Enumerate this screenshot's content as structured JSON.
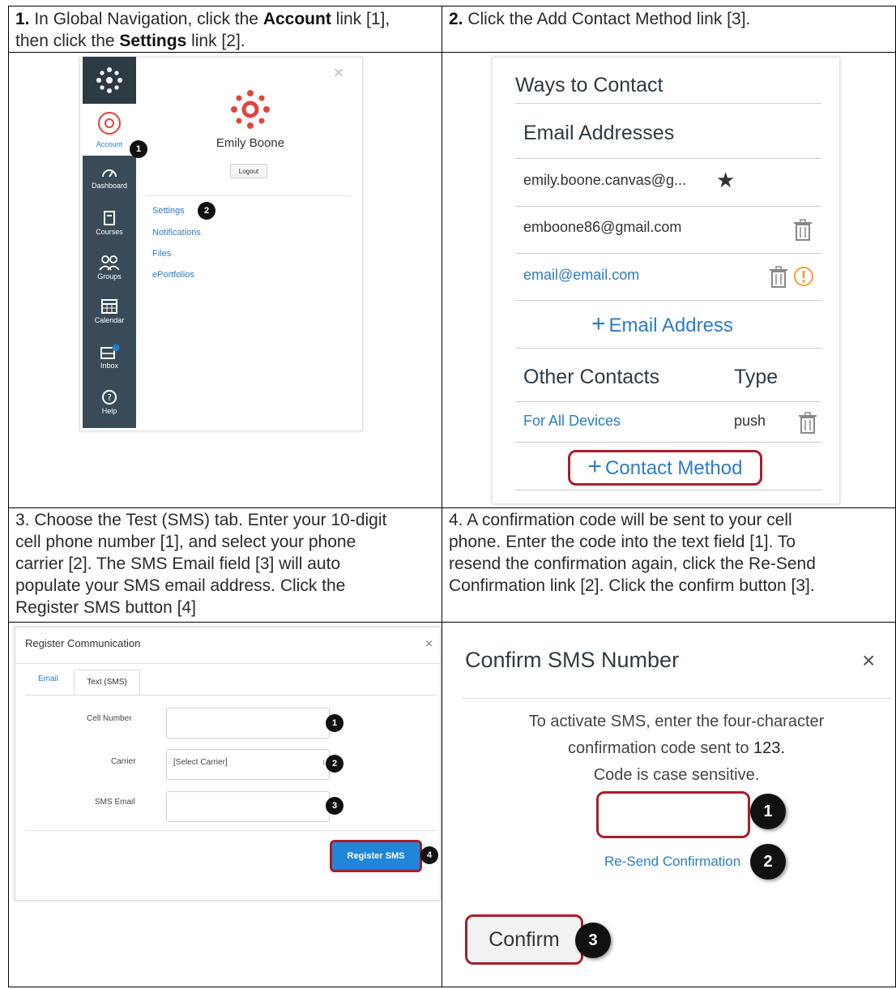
{
  "steps": {
    "s1": {
      "num": "1.",
      "t1": " In Global Navigation, click the ",
      "b1": "Account",
      "t2": " link [1],",
      "t3": "then click the ",
      "b2": "Settings",
      "t4": " link [2]."
    },
    "s2": {
      "num": "2.",
      "text": " Click the Add Contact Method link [3]."
    },
    "s3": {
      "lines": [
        "3. Choose the Test (SMS) tab. Enter your 10-digit",
        "cell phone number [1], and select your phone",
        "carrier [2]. The SMS Email field [3] will auto",
        "populate your SMS email address. Click the",
        "Register SMS button [4]"
      ]
    },
    "s4": {
      "lines": [
        "4. A confirmation code will be sent to your cell",
        "phone. Enter the code into the text field [1]. To",
        "resend the confirmation again, click the Re-Send",
        "Confirmation link [2]. Click the confirm button [3]."
      ]
    }
  },
  "panel1": {
    "nav": [
      "Account",
      "Dashboard",
      "Courses",
      "Groups",
      "Calendar",
      "Inbox",
      "Help"
    ],
    "user_name": "Emily Boone",
    "logout": "Logout",
    "links": [
      "Settings",
      "Notifications",
      "Files",
      "ePortfolios"
    ],
    "close": "×",
    "badges": [
      "1",
      "2"
    ]
  },
  "panel2": {
    "title": "Ways to Contact",
    "email_header": "Email Addresses",
    "emails": [
      "emily.boone.canvas@g...",
      "emboone86@gmail.com",
      "email@email.com"
    ],
    "add_email": "Email Address",
    "other_header": "Other Contacts",
    "type_header": "Type",
    "contact_name": "For All Devices",
    "contact_type": "push",
    "add_contact": "Contact Method",
    "colors": {
      "link": "#2d7cc3",
      "highlight": "#a51f2b"
    }
  },
  "panel3": {
    "title": "Register Communication",
    "close": "×",
    "tabs": [
      "Email",
      "Text (SMS)"
    ],
    "labels": [
      "Cell Number",
      "Carrier",
      "SMS Email"
    ],
    "carrier_value": "[Select Carrier]",
    "button": "Register SMS",
    "badges": [
      "1",
      "2",
      "3",
      "4"
    ]
  },
  "panel4": {
    "title": "Confirm SMS Number",
    "close": "×",
    "line1": "To activate SMS, enter the four-character",
    "line2_a": "confirmation code sent to ",
    "line2_b": "123.",
    "line3": "Code is case sensitive.",
    "resend": "Re-Send Confirmation",
    "button": "Confirm",
    "badges": [
      "1",
      "2",
      "3"
    ]
  }
}
